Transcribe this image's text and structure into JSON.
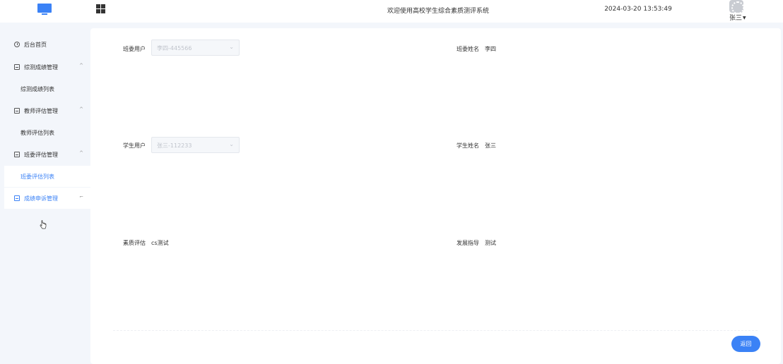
{
  "header": {
    "title": "欢迎使用高校学生综合素质测评系统",
    "datetime": "2024-03-20 13:53:49",
    "user_name": "张三",
    "logo_icon": "monitor-icon",
    "apps_icon": "grid-icon",
    "accent_color": "#3b82f6"
  },
  "sidebar": {
    "items": [
      {
        "label": "后台首页",
        "icon": "clock-icon"
      },
      {
        "label": "综测成绩管理",
        "icon": "doc-icon",
        "arrow": "^"
      },
      {
        "label": "综测成绩列表"
      },
      {
        "label": "教师评估管理",
        "icon": "doc-icon",
        "arrow": "^"
      },
      {
        "label": "教师评估列表"
      },
      {
        "label": "班委评估管理",
        "icon": "doc-icon",
        "arrow": "^"
      },
      {
        "label": "班委评估列表",
        "active": true
      },
      {
        "label": "成绩申诉管理",
        "icon": "doc-icon",
        "arrow": "⌐"
      }
    ]
  },
  "form": {
    "class_user_label": "班委用户",
    "class_user_value": "李四-445566",
    "class_name_label": "班委姓名",
    "class_name_value": "李四",
    "student_user_label": "学生用户",
    "student_user_value": "张三-112233",
    "student_name_label": "学生姓名",
    "student_name_value": "张三",
    "quality_label": "素质评估",
    "quality_value": "cs测试",
    "guidance_label": "发展指导",
    "guidance_value": "测试",
    "back_label": "返回"
  }
}
